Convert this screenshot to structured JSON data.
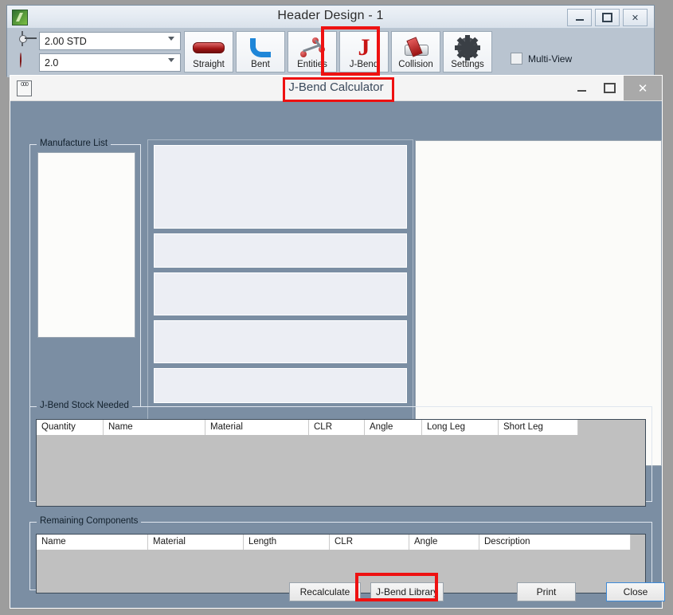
{
  "app_window": {
    "title": "Header Design - 1",
    "icon": "app-leaf-icon",
    "controls": [
      {
        "name": "minimize",
        "glyph": "—"
      },
      {
        "name": "maximize",
        "glyph": "□"
      },
      {
        "name": "close",
        "glyph": "✕"
      }
    ],
    "toolbar": {
      "pipe_size_combo": {
        "value": "2.00 STD",
        "icon": "pipe-size-icon"
      },
      "bend_radius_combo": {
        "value": "2.0",
        "icon": "bend-radius-icon"
      },
      "buttons": [
        {
          "label": "Straight",
          "icon": "straight-pipe-icon"
        },
        {
          "label": "Bent",
          "icon": "bent-pipe-icon"
        },
        {
          "label": "Entities",
          "icon": "entities-icon"
        },
        {
          "label": "J-Bend",
          "icon": "j-bend-icon"
        },
        {
          "label": "Collision",
          "icon": "collision-icon"
        },
        {
          "label": "Settings",
          "icon": "gear-icon"
        }
      ],
      "multi_view": {
        "label": "Multi-View",
        "checked": false
      }
    }
  },
  "dialog": {
    "title": "J-Bend Calculator",
    "icon": "calculator-icon",
    "icon_text": "000",
    "controls": [
      {
        "name": "minimize",
        "glyph": "—"
      },
      {
        "name": "maximize",
        "glyph": "□"
      },
      {
        "name": "close",
        "glyph": "✕"
      }
    ],
    "groups": {
      "manufacture_list": "Manufacture List",
      "stock_needed": "J-Bend Stock Needed",
      "remaining_components": "Remaining Components"
    },
    "stock_table": {
      "columns": [
        "Quantity",
        "Name",
        "Material",
        "CLR",
        "Angle",
        "Long Leg",
        "Short Leg"
      ],
      "rows": []
    },
    "remaining_table": {
      "columns": [
        "Name",
        "Material",
        "Length",
        "CLR",
        "Angle",
        "Description"
      ],
      "rows": []
    },
    "buttons": {
      "recalculate": "Recalculate",
      "jbend_library": "J-Bend Library",
      "print": "Print",
      "close": "Close"
    }
  },
  "annotations": {
    "highlight_color": "#ee1111",
    "targets": [
      "j-bend-toolbar-button",
      "dialog-title",
      "j-bend-library-button"
    ]
  }
}
